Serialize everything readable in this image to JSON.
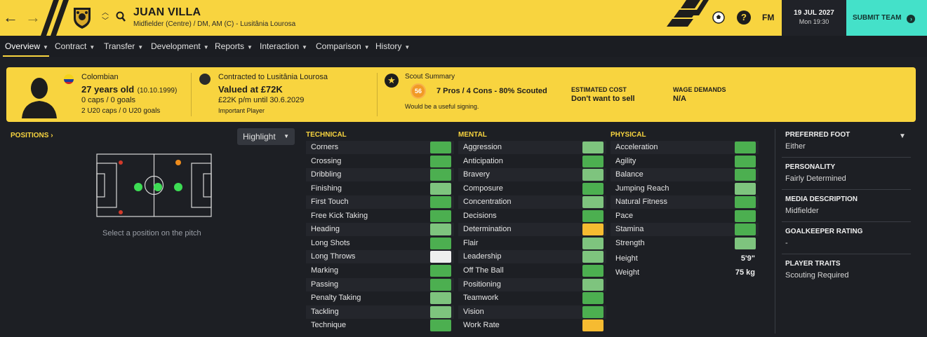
{
  "header": {
    "back_icon": "arrow-left-icon",
    "forward_icon": "arrow-right-icon",
    "player_name": "JUAN VILLA",
    "player_subtitle": "Midfielder (Centre) / DM, AM (C) - Lusitânia Lourosa",
    "help_label": "?",
    "fm_label": "FM",
    "date": "19 JUL 2027",
    "time": "Mon 19:30",
    "submit_label": "SUBMIT TEAM",
    "accent_color": "#f8d43f",
    "submit_color": "#44e1c9"
  },
  "tabs": [
    {
      "label": "Overview",
      "active": true
    },
    {
      "label": "Contract"
    },
    {
      "label": "Transfer"
    },
    {
      "label": "Development"
    },
    {
      "label": "Reports"
    },
    {
      "label": "Interaction"
    },
    {
      "label": "Comparison"
    },
    {
      "label": "History"
    }
  ],
  "info": {
    "nationality": "Colombian",
    "age": "27 years old",
    "dob": "(10.10.1999)",
    "caps": "0 caps / 0 goals",
    "youth_caps": "2 U20 caps / 0 U20 goals",
    "contract_label": "Contracted to Lusitânia Lourosa",
    "value": "Valued at £72K",
    "wage": "£22K p/m until 30.6.2029",
    "squad_status": "Important Player",
    "scout_title": "Scout Summary",
    "scout_rating": "56",
    "scout_summary": "7 Pros / 4 Cons - 80% Scouted",
    "scout_note": "Would be a useful signing.",
    "estimated_cost_label": "ESTIMATED COST",
    "estimated_cost": "Don't want to sell",
    "wage_demands_label": "WAGE DEMANDS",
    "wage_demands": "N/A"
  },
  "positions": {
    "title": "POSITIONS",
    "title_chevron": "›",
    "highlight_label": "Highlight",
    "caption": "Select a position on the pitch"
  },
  "attributes": {
    "technical_title": "TECHNICAL",
    "mental_title": "MENTAL",
    "physical_title": "PHYSICAL",
    "technical": [
      {
        "name": "Corners",
        "color": "#4caf50"
      },
      {
        "name": "Crossing",
        "color": "#4caf50"
      },
      {
        "name": "Dribbling",
        "color": "#4caf50"
      },
      {
        "name": "Finishing",
        "color": "#7ec47e"
      },
      {
        "name": "First Touch",
        "color": "#4caf50"
      },
      {
        "name": "Free Kick Taking",
        "color": "#4caf50"
      },
      {
        "name": "Heading",
        "color": "#7ec47e"
      },
      {
        "name": "Long Shots",
        "color": "#4caf50"
      },
      {
        "name": "Long Throws",
        "color": "#eeeeee"
      },
      {
        "name": "Marking",
        "color": "#4caf50"
      },
      {
        "name": "Passing",
        "color": "#4caf50"
      },
      {
        "name": "Penalty Taking",
        "color": "#7ec47e"
      },
      {
        "name": "Tackling",
        "color": "#7ec47e"
      },
      {
        "name": "Technique",
        "color": "#4caf50"
      }
    ],
    "mental": [
      {
        "name": "Aggression",
        "color": "#7ec47e"
      },
      {
        "name": "Anticipation",
        "color": "#4caf50"
      },
      {
        "name": "Bravery",
        "color": "#7ec47e"
      },
      {
        "name": "Composure",
        "color": "#4caf50"
      },
      {
        "name": "Concentration",
        "color": "#7ec47e"
      },
      {
        "name": "Decisions",
        "color": "#4caf50"
      },
      {
        "name": "Determination",
        "color": "#f6bb31"
      },
      {
        "name": "Flair",
        "color": "#7ec47e"
      },
      {
        "name": "Leadership",
        "color": "#7ec47e"
      },
      {
        "name": "Off The Ball",
        "color": "#4caf50"
      },
      {
        "name": "Positioning",
        "color": "#7ec47e"
      },
      {
        "name": "Teamwork",
        "color": "#4caf50"
      },
      {
        "name": "Vision",
        "color": "#4caf50"
      },
      {
        "name": "Work Rate",
        "color": "#f6bb31"
      }
    ],
    "physical": [
      {
        "name": "Acceleration",
        "color": "#4caf50"
      },
      {
        "name": "Agility",
        "color": "#4caf50"
      },
      {
        "name": "Balance",
        "color": "#4caf50"
      },
      {
        "name": "Jumping Reach",
        "color": "#7ec47e"
      },
      {
        "name": "Natural Fitness",
        "color": "#4caf50"
      },
      {
        "name": "Pace",
        "color": "#4caf50"
      },
      {
        "name": "Stamina",
        "color": "#4caf50"
      },
      {
        "name": "Strength",
        "color": "#7ec47e"
      }
    ],
    "height_label": "Height",
    "height": "5'9\"",
    "weight_label": "Weight",
    "weight": "75 kg"
  },
  "details": [
    {
      "label": "PREFERRED FOOT",
      "value": "Either"
    },
    {
      "label": "PERSONALITY",
      "value": "Fairly Determined"
    },
    {
      "label": "MEDIA DESCRIPTION",
      "value": "Midfielder"
    },
    {
      "label": "GOALKEEPER RATING",
      "value": "-"
    },
    {
      "label": "PLAYER TRAITS",
      "value": "Scouting Required"
    }
  ]
}
